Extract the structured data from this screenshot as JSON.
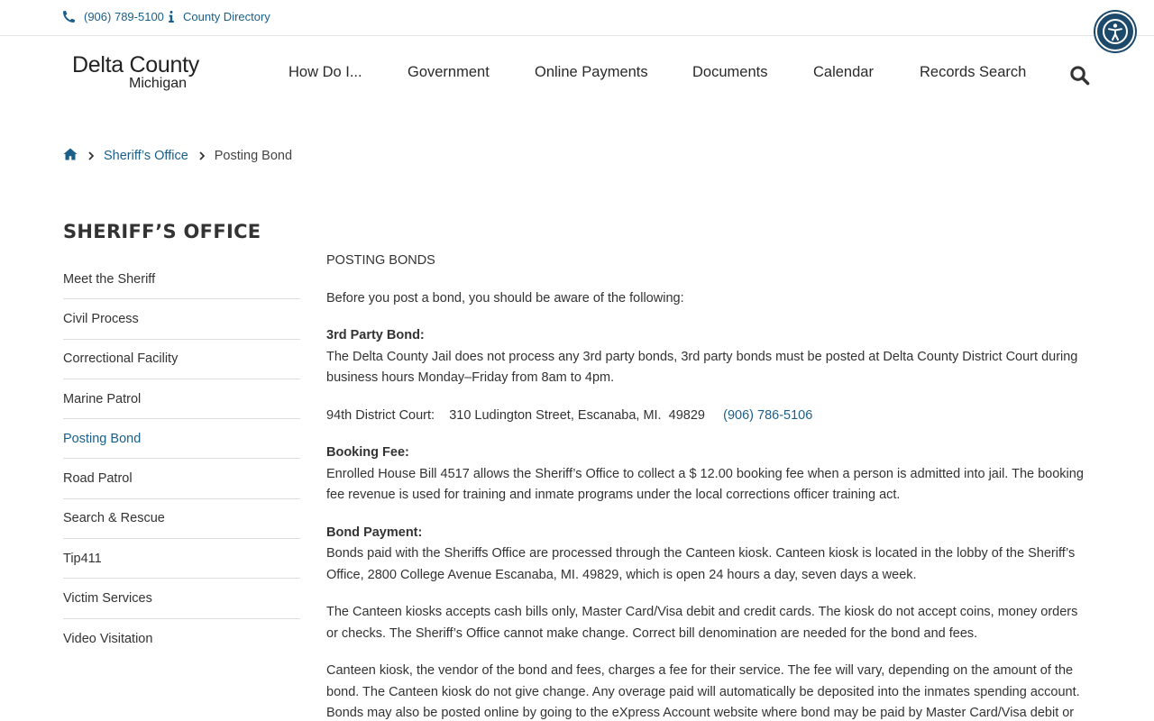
{
  "utility": {
    "phone": "(906) 789-5100",
    "directory": "County Directory"
  },
  "logo": {
    "line1": "Delta County",
    "line2": "Michigan"
  },
  "nav": [
    {
      "label": "How Do I..."
    },
    {
      "label": "Government"
    },
    {
      "label": "Online Payments"
    },
    {
      "label": "Documents"
    },
    {
      "label": "Calendar"
    },
    {
      "label": "Records Search"
    }
  ],
  "breadcrumb": {
    "parent": "Sheriff’s Office",
    "current": "Posting Bond"
  },
  "sidebar": {
    "title": "SHERIFF’S OFFICE",
    "items": [
      {
        "label": "Meet the Sheriff"
      },
      {
        "label": "Civil Process"
      },
      {
        "label": "Correctional Facility"
      },
      {
        "label": "Marine Patrol"
      },
      {
        "label": "Posting Bond"
      },
      {
        "label": "Road Patrol"
      },
      {
        "label": "Search & Rescue"
      },
      {
        "label": "Tip411"
      },
      {
        "label": "Victim Services"
      },
      {
        "label": "Video Visitation"
      }
    ]
  },
  "content": {
    "title": "POSTING BONDS",
    "intro": "Before you post a bond, you should be aware of the following:",
    "third_party_heading": "3rd Party Bond:",
    "third_party_text": "The Delta County Jail does not process any 3rd party bonds, 3rd party bonds must be posted at Delta County District Court during business hours Monday–Friday from 8am to 4pm.",
    "court_name": "94th District Court:",
    "court_address": "310 Ludington Street, Escanaba, MI.  49829",
    "court_phone": "(906) 786-5106",
    "booking_heading": "Booking Fee:",
    "booking_text": "Enrolled House Bill 4517 allows the Sheriff’s Office to collect a $ 12.00 booking fee when a person is admitted into jail. The booking fee revenue is used for training and inmate programs under the local corrections officer training act.",
    "bond_heading": "Bond Payment:",
    "bond_text": "Bonds paid with the Sheriffs Office are processed through the Canteen kiosk.  Canteen kiosk is located in the lobby of the Sheriff’s Office, 2800 College Avenue Escanaba, MI. 49829, which is open 24 hours a day, seven days a week.",
    "kiosk_text": "The Canteen kiosks  accepts cash bills only, Master Card/Visa debit and credit cards. The kiosk do not accept coins, money orders or checks. The Sheriff’s Office cannot make change. Correct bill denomination are needed for the bond and fees.",
    "fee_text": "Canteen kiosk, the vendor of the bond and fees, charges a fee for their service. The fee will vary, depending on the amount of the bond. The Canteen kiosk do not give change.  Any overage paid will automatically be deposited into the inmates spending account.",
    "online_text": "Bonds may also be posted online by going to the eXpress Account website where bond may be paid by Master Card/Visa debit or credit"
  },
  "colors": {
    "link": "#1a5f8a",
    "accessibility": "#1d4a6b"
  }
}
